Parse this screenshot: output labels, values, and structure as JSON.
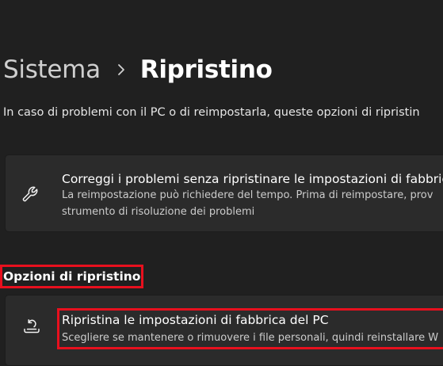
{
  "breadcrumb": {
    "parent": "Sistema",
    "current": "Ripristino"
  },
  "intro_text": "In caso di problemi con il PC o di reimpostarla, queste opzioni di ripristin",
  "troubleshoot_card": {
    "icon": "wrench-icon",
    "title": "Correggi i problemi senza ripristinare le impostazioni di fabbric",
    "description_line1": "La reimpostazione può richiedere del tempo. Prima di reimpostare, prov",
    "description_line2": "strumento di risoluzione dei problemi"
  },
  "recovery_options": {
    "header": "Opzioni di ripristino",
    "reset_card": {
      "icon": "reset-pc-icon",
      "title": "Ripristina le impostazioni di fabbrica del PC",
      "description": "Scegliere se mantenere o rimuovere i file personali, quindi reinstallare W"
    }
  },
  "colors": {
    "background": "#202020",
    "card": "#2b2b2b",
    "highlight": "#e8101e"
  }
}
